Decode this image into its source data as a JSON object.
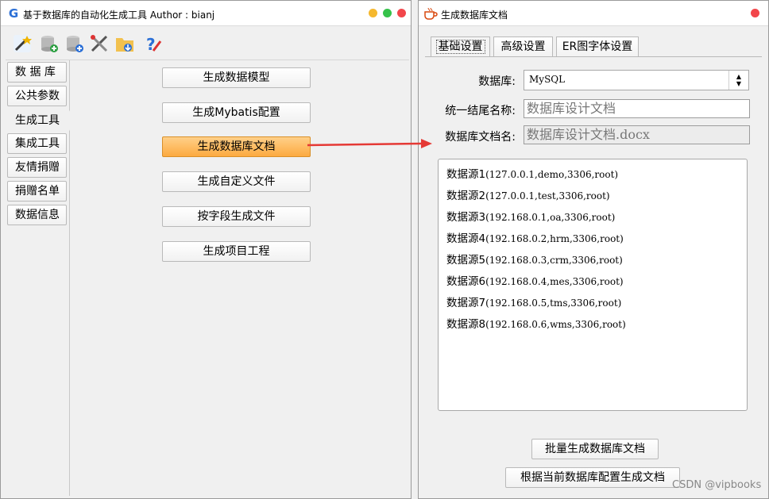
{
  "left_window": {
    "title": "基于数据库的自动化生成工具  Author : bianj",
    "toolbar": [
      "wand-icon",
      "database-add-icon",
      "database-plus-icon",
      "tools-icon",
      "folder-download-icon",
      "help-icon"
    ],
    "side_tabs": [
      "数 据 库",
      "公共参数",
      "生成工具",
      "集成工具",
      "友情捐赠",
      "捐赠名单",
      "数据信息"
    ],
    "selected_tab": "生成工具",
    "buttons": [
      "生成数据模型",
      "生成Mybatis配置",
      "生成数据库文档",
      "生成自定义文件",
      "按字段生成文件",
      "生成项目工程"
    ],
    "active_button": "生成数据库文档"
  },
  "right_window": {
    "title": "生成数据库文档",
    "tabs": [
      "基础设置",
      "高级设置",
      "ER图字体设置"
    ],
    "selected_tab": "基础设置",
    "db_label": "数据库:",
    "db_value": "MySQL",
    "suffix_label": "统一结尾名称:",
    "suffix_value": "数据库设计文档",
    "docname_label": "数据库文档名:",
    "docname_value": "数据库设计文档.docx",
    "datasources": [
      {
        "name": "数据源1",
        "conn": "(127.0.0.1,demo,3306,root)"
      },
      {
        "name": "数据源2",
        "conn": "(127.0.0.1,test,3306,root)"
      },
      {
        "name": "数据源3",
        "conn": "(192.168.0.1,oa,3306,root)"
      },
      {
        "name": "数据源4",
        "conn": "(192.168.0.2,hrm,3306,root)"
      },
      {
        "name": "数据源5",
        "conn": "(192.168.0.3,crm,3306,root)"
      },
      {
        "name": "数据源6",
        "conn": "(192.168.0.4,mes,3306,root)"
      },
      {
        "name": "数据源7",
        "conn": "(192.168.0.5,tms,3306,root)"
      },
      {
        "name": "数据源8",
        "conn": "(192.168.0.6,wms,3306,root)"
      }
    ],
    "batch_button": "批量生成数据库文档",
    "current_button": "根据当前数据库配置生成文档"
  },
  "watermark": "CSDN @vipbooks",
  "colors": {
    "accent_orange": "#fcaa40",
    "arrow": "#e53935",
    "dot_yellow": "#f5b82e",
    "dot_green": "#35c24a",
    "dot_red": "#f2464b"
  }
}
